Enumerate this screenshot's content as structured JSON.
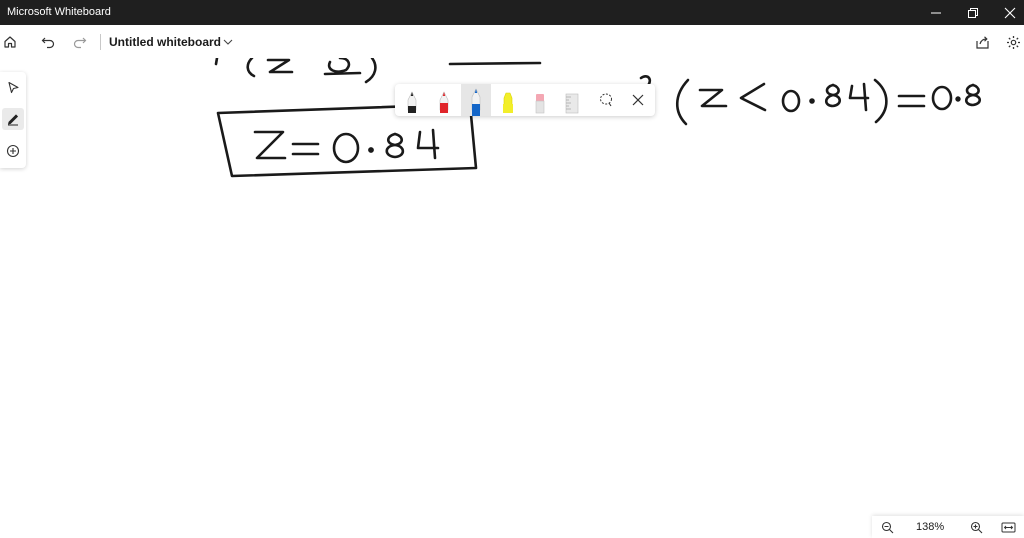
{
  "window": {
    "app_title": "Microsoft Whiteboard",
    "minimize_glyph": "—",
    "restore_glyph": "⧉",
    "close_glyph": "✕"
  },
  "toolbar": {
    "document_title": "Untitled whiteboard"
  },
  "left_rail": {
    "tools": [
      "select-icon",
      "pen-icon",
      "add-icon"
    ]
  },
  "pen_tray": {
    "pens": [
      {
        "name": "black-pen",
        "color": "#222222"
      },
      {
        "name": "red-pen",
        "color": "#e0262b"
      },
      {
        "name": "blue-pen",
        "color": "#1466c8",
        "selected": true
      },
      {
        "name": "yellow-highlighter",
        "color": "#f2ee2a"
      },
      {
        "name": "eraser",
        "color": "#f4a7b3"
      },
      {
        "name": "ruler",
        "color": "#cfcfcf"
      }
    ]
  },
  "zoom": {
    "level": "138%"
  },
  "canvas": {
    "ink_color": "#1a1a1a"
  }
}
